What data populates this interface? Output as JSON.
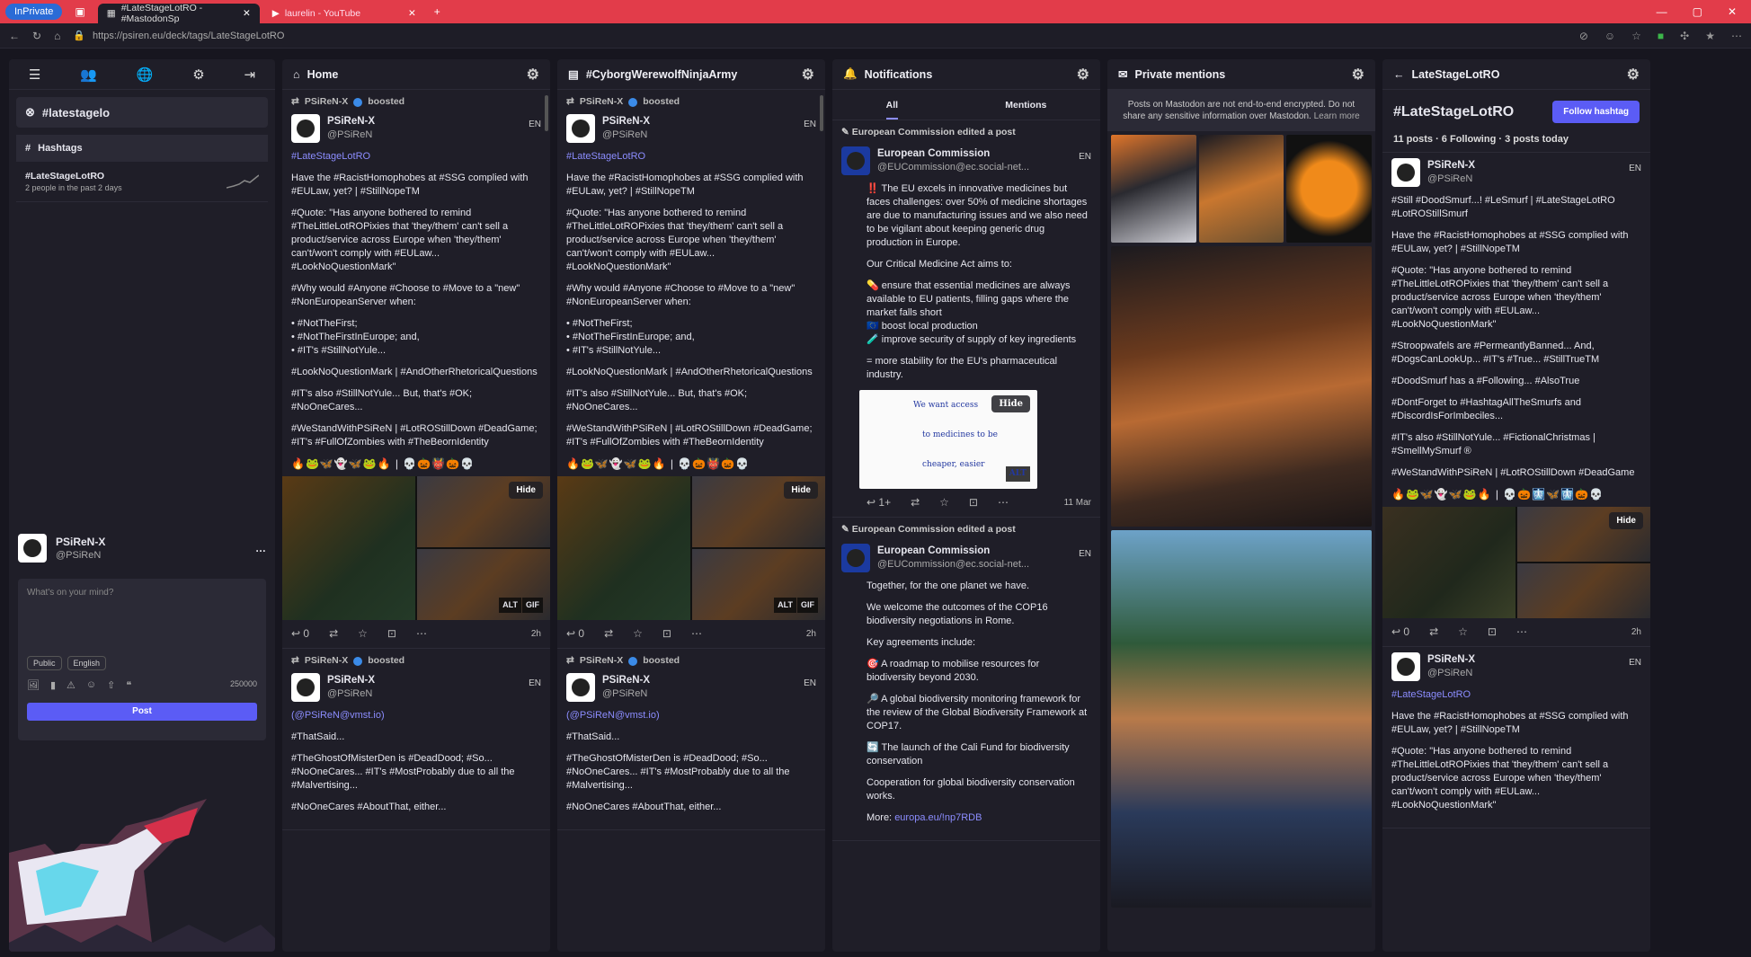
{
  "browser": {
    "inprivate": "InPrivate",
    "tabs": [
      {
        "title": "#LateStageLotRO - #MastodonSp",
        "active": true
      },
      {
        "title": "laurelin - YouTube",
        "active": false
      }
    ],
    "url": "https://psiren.eu/deck/tags/LateStageLotRO"
  },
  "nav": {
    "search_tag": "#latestagelo",
    "hashtags_label": "Hashtags",
    "trend_tag": "#LateStageLotRO",
    "trend_sub": "2 people in the past 2 days",
    "me_name": "PSiReN-X",
    "me_handle": "@PSiReN",
    "composer_placeholder": "What's on your mind?",
    "visibility": "Public",
    "language": "English",
    "char_count": "250000",
    "post_label": "Post"
  },
  "home": {
    "title": "Home",
    "boosted": "boosted",
    "name": "PSiReN-X",
    "handle": "@PSiReN",
    "lang": "EN",
    "p1": "#LateStageLotRO",
    "p2": "Have the #RacistHomophobes at #SSG complied with #EULaw, yet? | #StillNopeTM",
    "p3": "#Quote: \"Has anyone bothered to remind #TheLittleLotROPixies that 'they/them' can't sell a product/service across Europe when 'they/them' can't/won't comply with #EULaw... #LookNoQuestionMark\"",
    "p4": "#Why would #Anyone #Choose to #Move to a \"new\" #NonEuropeanServer when:",
    "p5": "•     #NotTheFirst;\n•     #NotTheFirstInEurope; and,\n•     #IT's #StillNotYule...",
    "p6": "#LookNoQuestionMark | #AndOtherRhetoricalQuestions",
    "p7": "#IT's also #StillNotYule... But, that's #OK; #NoOneCares...",
    "p8": "#WeStandWithPSiReN | #LotROStillDown #DeadGame; #IT's #FullOfZombies with #TheBeornIdentity",
    "emoji": "🔥🐸🦋👻🦋🐸🔥 | 💀🎃👹🎃💀",
    "hide": "Hide",
    "alt": "ALT",
    "gif": "GIF",
    "replies": "0",
    "time": "2h",
    "post2_p1": "(@PSiReN@vmst.io)",
    "post2_p2": "#ThatSaid...",
    "post2_p3": "#TheGhostOfMisterDen is #DeadDood; #So... #NoOneCares... #IT's #MostProbably due to all the #Malvertising...",
    "post2_p4": "#NoOneCares #AboutThat, either..."
  },
  "army": {
    "title": "#CyborgWerewolfNinjaArmy"
  },
  "notif": {
    "title": "Notifications",
    "tab_all": "All",
    "tab_mentions": "Mentions",
    "edited": "European Commission edited a post",
    "ec_name": "European Commission",
    "ec_handle": "@EUCommission@ec.social-net...",
    "lang": "EN",
    "n1": "‼️ The EU excels in innovative medicines but faces challenges: over 50% of medicine shortages are due to manufacturing issues and we also need to be vigilant about keeping generic drug production in Europe.",
    "n2": "Our Critical Medicine Act aims to:",
    "n3": "💊 ensure that essential medicines are always available to EU patients, filling gaps where the market falls short\n🇪🇺 boost local production\n🧪 improve security of supply of key ingredients",
    "n4": "= more stability for the EU's pharmaceutical industry.",
    "doc_l1": "We want access",
    "doc_l2": "to medicines to be",
    "doc_l3": "cheaper, easier",
    "hide": "Hide",
    "alt": "ALT",
    "replies": "1+",
    "time": "11 Mar",
    "m1": "Together, for the one planet we have.",
    "m2": "We welcome the outcomes of the COP16 biodiversity negotiations in Rome.",
    "m3": "Key agreements include:",
    "m4": "🎯 A roadmap to mobilise resources for biodiversity beyond 2030.",
    "m5": "🔎 A global biodiversity monitoring framework for the review of the Global Biodiversity Framework at COP17.",
    "m6": "🔄 The launch of the Cali Fund for biodiversity conservation",
    "m7": "Cooperation for global biodiversity conservation works.",
    "m8_label": "More:",
    "m8_link": "europa.eu/!np7RDB"
  },
  "pm": {
    "title": "Private mentions",
    "note": "Posts on Mastodon are not end-to-end encrypted. Do not share any sensitive information over Mastodon.",
    "learn": "Learn more"
  },
  "tag": {
    "header": "LateStageLotRO",
    "title": "#LateStageLotRO",
    "follow": "Follow hashtag",
    "stats": "11 posts · 6 Following · 3 posts today",
    "t1": "#Still #DoodSmurf...! #LeSmurf | #LateStageLotRO #LotROStillSmurf",
    "t2": "Have the #RacistHomophobes at #SSG complied with #EULaw, yet? | #StillNopeTM",
    "t3": "#Quote: \"Has anyone bothered to remind #TheLittleLotROPixies that 'they/them' can't sell a product/service across Europe when 'they/them' can't/won't comply with #EULaw... #LookNoQuestionMark\"",
    "t4": "#Stroopwafels are #PermeantlyBanned... And, #DogsCanLookUp... #IT's #True... #StillTrueTM",
    "t5": "#DoodSmurf has a #Following... #AlsoTrue",
    "t6": "#DontForget to #HashtagAllTheSmurfs and #DiscordIsForImbeciles...",
    "t7": "#IT's also #StillNotYule... #FictionalChristmas | #SmellMySmurf ®",
    "t8": "#WeStandWithPSiReN | #LotROStillDown #DeadGame",
    "emoji": "🔥🐸🦋👻🦋🐸🔥 | 💀🎃🩻🦋🩻🎃💀",
    "hide": "Hide",
    "replies": "0",
    "time": "2h",
    "b1": "#LateStageLotRO",
    "b2": "Have the #RacistHomophobes at #SSG complied with #EULaw, yet? | #StillNopeTM",
    "b3": "#Quote: \"Has anyone bothered to remind #TheLittleLotROPixies that 'they/them' can't sell a product/service across Europe when 'they/them' can't/won't comply with #EULaw... #LookNoQuestionMark\""
  },
  "colors": {
    "accent": "#5b5cf5",
    "hashtag": "#8c8dff",
    "browser_bar": "#e23c4a"
  }
}
